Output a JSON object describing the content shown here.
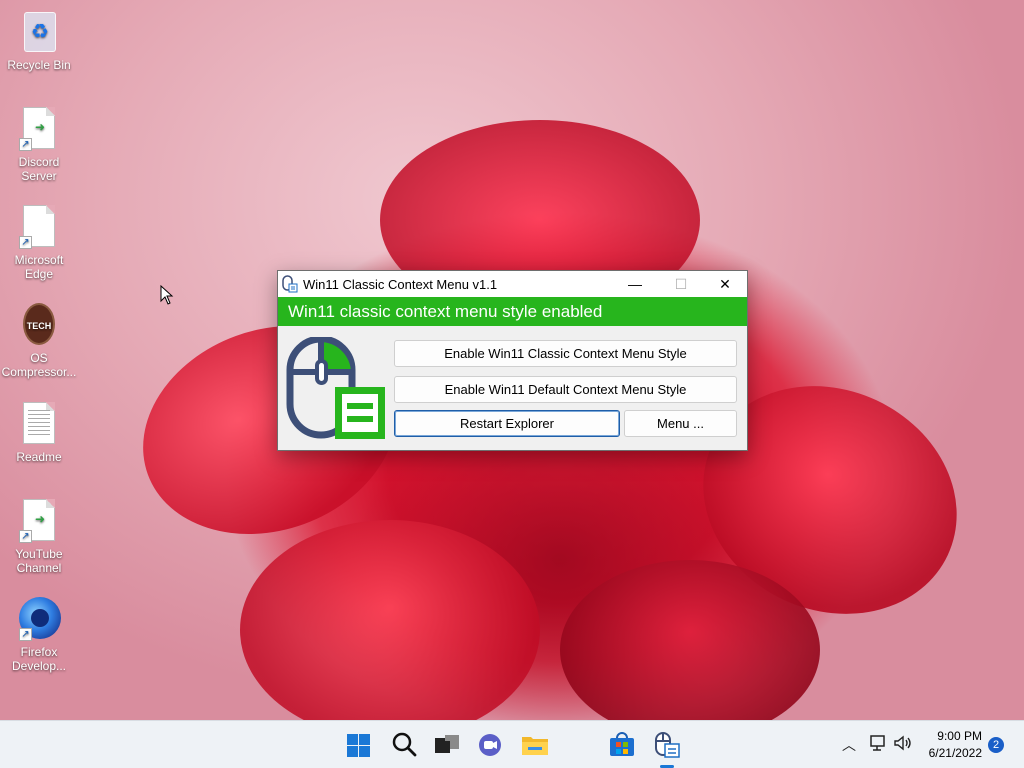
{
  "desktop": {
    "icons": [
      {
        "label": "Recycle Bin",
        "icon": "recycle-bin-icon"
      },
      {
        "label": "Discord\nServer",
        "icon": "shortcut-file-icon"
      },
      {
        "label": "Microsoft\nEdge",
        "icon": "blank-file-icon"
      },
      {
        "label": "OS\nCompressor...",
        "icon": "tech-badge-icon"
      },
      {
        "label": "Readme",
        "icon": "text-file-icon"
      },
      {
        "label": "YouTube\nChannel",
        "icon": "shortcut-file-icon"
      },
      {
        "label": "Firefox\nDevelop...",
        "icon": "firefox-icon"
      }
    ],
    "badge_text": "TECH"
  },
  "window": {
    "title": "Win11 Classic Context Menu v1.1",
    "status": "Win11 classic context menu style enabled",
    "status_color": "#27b51d",
    "buttons": {
      "classic": "Enable Win11 Classic Context Menu Style",
      "default": "Enable Win11 Default Context Menu Style",
      "restart": "Restart Explorer",
      "menu": "Menu ..."
    },
    "controls": {
      "minimize": "—",
      "maximize": "☐",
      "close": "✕"
    }
  },
  "taskbar": {
    "apps": [
      "start-icon",
      "search-icon",
      "task-view-icon",
      "chat-icon",
      "file-explorer-icon",
      "store-icon",
      "context-menu-app-icon"
    ],
    "clock": {
      "time": "9:00 PM",
      "date": "6/21/2022"
    },
    "notifications": "2",
    "tray_chevron": "^",
    "accent": "#1a78d6"
  }
}
